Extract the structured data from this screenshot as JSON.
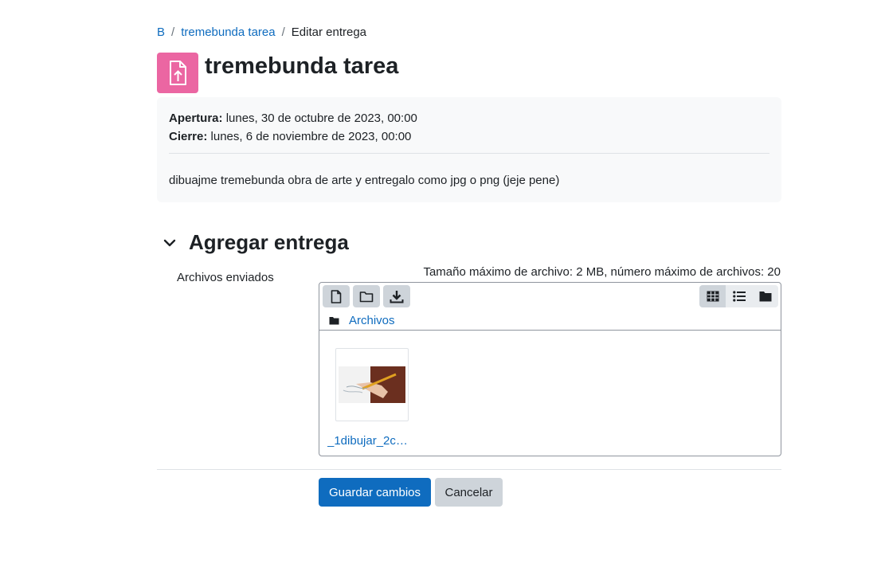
{
  "breadcrumb": {
    "items": [
      "B",
      "tremebunda tarea"
    ],
    "current": "Editar entrega"
  },
  "page": {
    "title": "tremebunda tarea"
  },
  "dates": {
    "open_label": "Apertura:",
    "open_value": "lunes, 30 de octubre de 2023, 00:00",
    "close_label": "Cierre:",
    "close_value": "lunes, 6 de noviembre de 2023, 00:00",
    "description": "dibuajme tremebunda obra de arte y entregalo como jpg o png (jeje pene)"
  },
  "section": {
    "title": "Agregar entrega"
  },
  "filemanager": {
    "field_label": "Archivos enviados",
    "limits": "Tamaño máximo de archivo: 2 MB, número máximo de archivos: 20",
    "path_label": "Archivos",
    "files": [
      {
        "name": "_1dibujar_2c…"
      }
    ]
  },
  "buttons": {
    "save": "Guardar cambios",
    "cancel": "Cancelar"
  },
  "colors": {
    "accent": "#0f6cbf",
    "activity_icon": "#eb66a2"
  }
}
